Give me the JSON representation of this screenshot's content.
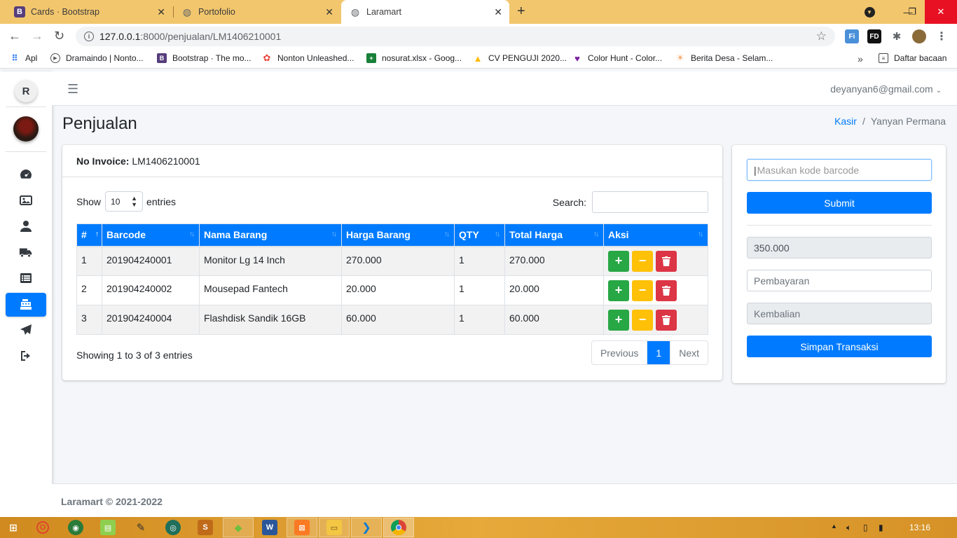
{
  "browser": {
    "tabs": [
      {
        "title": "Cards · Bootstrap",
        "favicon": "B",
        "favicon_color": "#563d7c"
      },
      {
        "title": "Portofolio",
        "favicon": "globe",
        "favicon_color": "#5f6368"
      },
      {
        "title": "Laramart",
        "favicon": "globe",
        "favicon_color": "#5f6368"
      }
    ],
    "url_host": "127.0.0.1",
    "url_path": ":8000/penjualan/LM1406210001",
    "bookmarks": [
      {
        "label": "Apl",
        "color": "#4285f4"
      },
      {
        "label": "Dramaindo | Nonto...",
        "color": "#555555"
      },
      {
        "label": "Bootstrap · The mo...",
        "color": "#563d7c"
      },
      {
        "label": "Nonton Unleashed...",
        "color": "#e8453c"
      },
      {
        "label": "nosurat.xlsx - Goog...",
        "color": "#188038"
      },
      {
        "label": "CV PENGUJI 2020...",
        "color": "#fbbc04"
      },
      {
        "label": "Color Hunt - Color...",
        "color": "#7b1fa2"
      },
      {
        "label": "Berita Desa - Selam...",
        "color": "#f4a261"
      }
    ],
    "reading_list": "Daftar bacaan"
  },
  "app": {
    "brand_letter": "R",
    "user_email": "deyanyan6@gmail.com",
    "page_title": "Penjualan",
    "breadcrumb": {
      "link": "Kasir",
      "current": "Yanyan Permana"
    },
    "invoice_label": "No Invoice:",
    "invoice_value": "LM1406210001",
    "show_label": "Show",
    "show_value": "10",
    "entries_label": "entries",
    "search_label": "Search:",
    "table": {
      "headers": [
        "#",
        "Barcode",
        "Nama Barang",
        "Harga Barang",
        "QTY",
        "Total Harga",
        "Aksi"
      ],
      "rows": [
        {
          "no": "1",
          "barcode": "201904240001",
          "nama": "Monitor Lg 14 Inch",
          "harga": "270.000",
          "qty": "1",
          "total": "270.000"
        },
        {
          "no": "2",
          "barcode": "201904240002",
          "nama": "Mousepad Fantech",
          "harga": "20.000",
          "qty": "1",
          "total": "20.000"
        },
        {
          "no": "3",
          "barcode": "201904240004",
          "nama": "Flashdisk Sandik 16GB",
          "harga": "60.000",
          "qty": "1",
          "total": "60.000"
        }
      ]
    },
    "info": "Showing 1 to 3 of 3 entries",
    "pager": {
      "prev": "Previous",
      "current": "1",
      "next": "Next"
    },
    "side": {
      "barcode_placeholder": "Masukan kode barcode",
      "submit_label": "Submit",
      "total_value": "350.000",
      "payment_placeholder": "Pembayaran",
      "change_placeholder": "Kembalian",
      "save_label": "Simpan Transaksi"
    },
    "footer": "Laramart © 2021-2022"
  },
  "taskbar": {
    "time": "13:16"
  },
  "colors": {
    "primary": "#007bff",
    "success": "#28a745",
    "warning": "#ffc107",
    "danger": "#dc3545",
    "tabbar": "#f2c66d"
  }
}
